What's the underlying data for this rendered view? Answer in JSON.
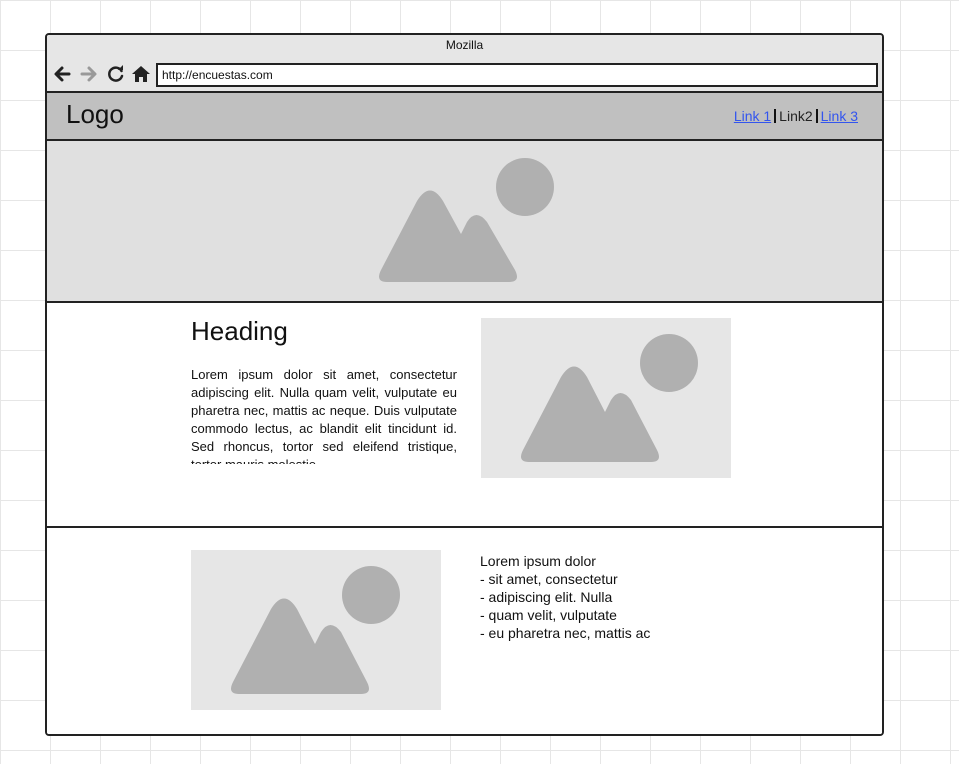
{
  "window": {
    "title": "Mozilla"
  },
  "toolbar": {
    "back_icon": "arrow-left-icon",
    "forward_icon": "arrow-right-icon",
    "reload_icon": "reload-icon",
    "home_icon": "home-icon",
    "url": "http://encuestas.com"
  },
  "header": {
    "logo": "Logo",
    "links": [
      {
        "label": "Link 1",
        "active": false
      },
      {
        "label": "Link2",
        "active": true
      },
      {
        "label": "Link 3",
        "active": false
      }
    ]
  },
  "hero": {
    "image_icon": "image-placeholder-icon"
  },
  "section1": {
    "heading": "Heading",
    "paragraph": "Lorem ipsum dolor sit amet, consectetur adipiscing elit. Nulla quam velit, vulputate eu pharetra nec, mattis ac neque. Duis vulputate commodo lectus, ac blandit elit tincidunt id. Sed rhoncus, tortor sed eleifend tristique, tortor mauris molestie",
    "image_icon": "image-placeholder-icon"
  },
  "section2": {
    "image_icon": "image-placeholder-icon",
    "lines": [
      "Lorem ipsum dolor",
      "- sit amet, consectetur",
      "- adipiscing elit. Nulla",
      "- quam velit, vulputate",
      "- eu pharetra nec, mattis ac"
    ]
  },
  "colors": {
    "header_bg": "#c0c0c0",
    "hero_bg": "#e0e0e0",
    "placeholder_bg": "#e6e6e6",
    "placeholder_shape": "#b0b0b0",
    "link": "#3355ee"
  }
}
